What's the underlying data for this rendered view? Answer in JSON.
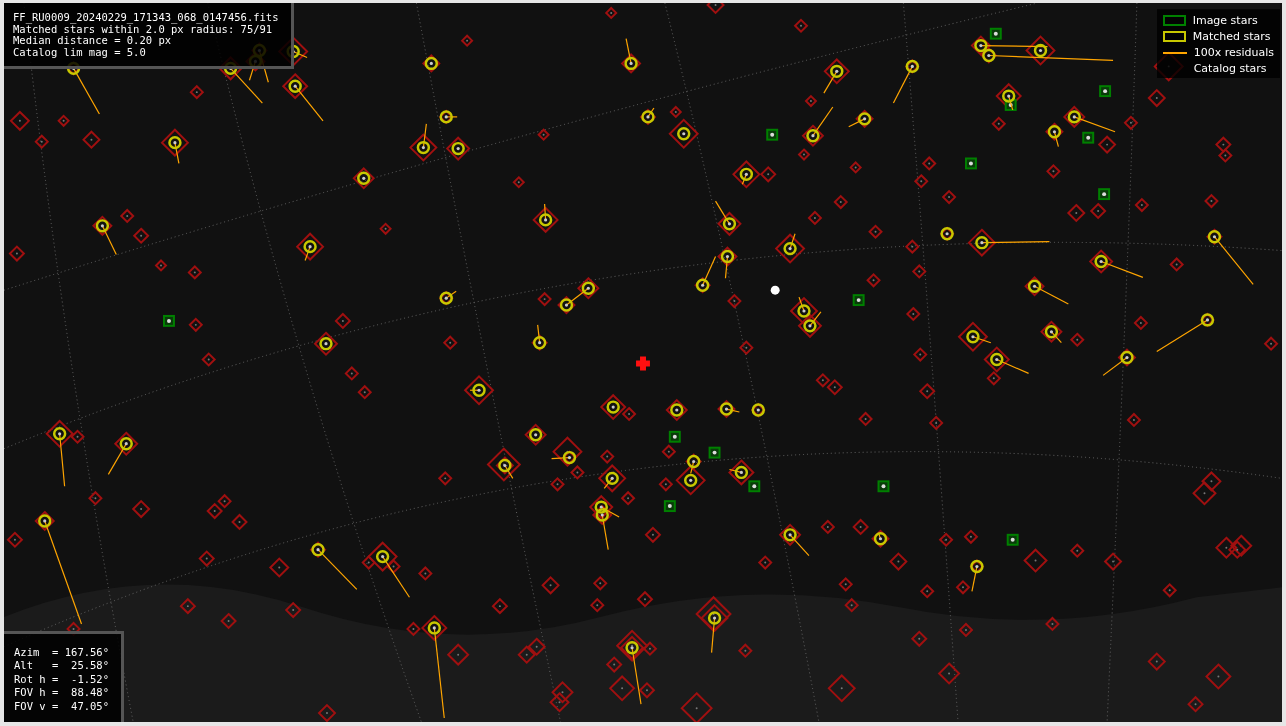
{
  "plot_info": {
    "lines": [
      "FF_RU0009_20240229_171343_068_0147456.fits",
      "Matched stars within 2.0 px radius: 75/91",
      "Median distance = 0.20 px",
      "Catalog lim mag = 5.0"
    ]
  },
  "legend": [
    {
      "kind": "box",
      "label": "Image stars",
      "color": "#008000"
    },
    {
      "kind": "box",
      "label": "Matched stars",
      "color": "#c8c800"
    },
    {
      "kind": "line",
      "label": "100x residuals",
      "color": "#ffa500"
    },
    {
      "kind": "label",
      "label": "Catalog stars"
    }
  ],
  "pointing": [
    {
      "label": "Azim  =",
      "value": "167.56°"
    },
    {
      "label": "Alt   =",
      "value": " 25.58°"
    },
    {
      "label": "Rot h =",
      "value": " -1.52°"
    },
    {
      "label": "FOV h =",
      "value": " 88.48°"
    },
    {
      "label": "FOV v =",
      "value": " 47.05°"
    }
  ]
}
